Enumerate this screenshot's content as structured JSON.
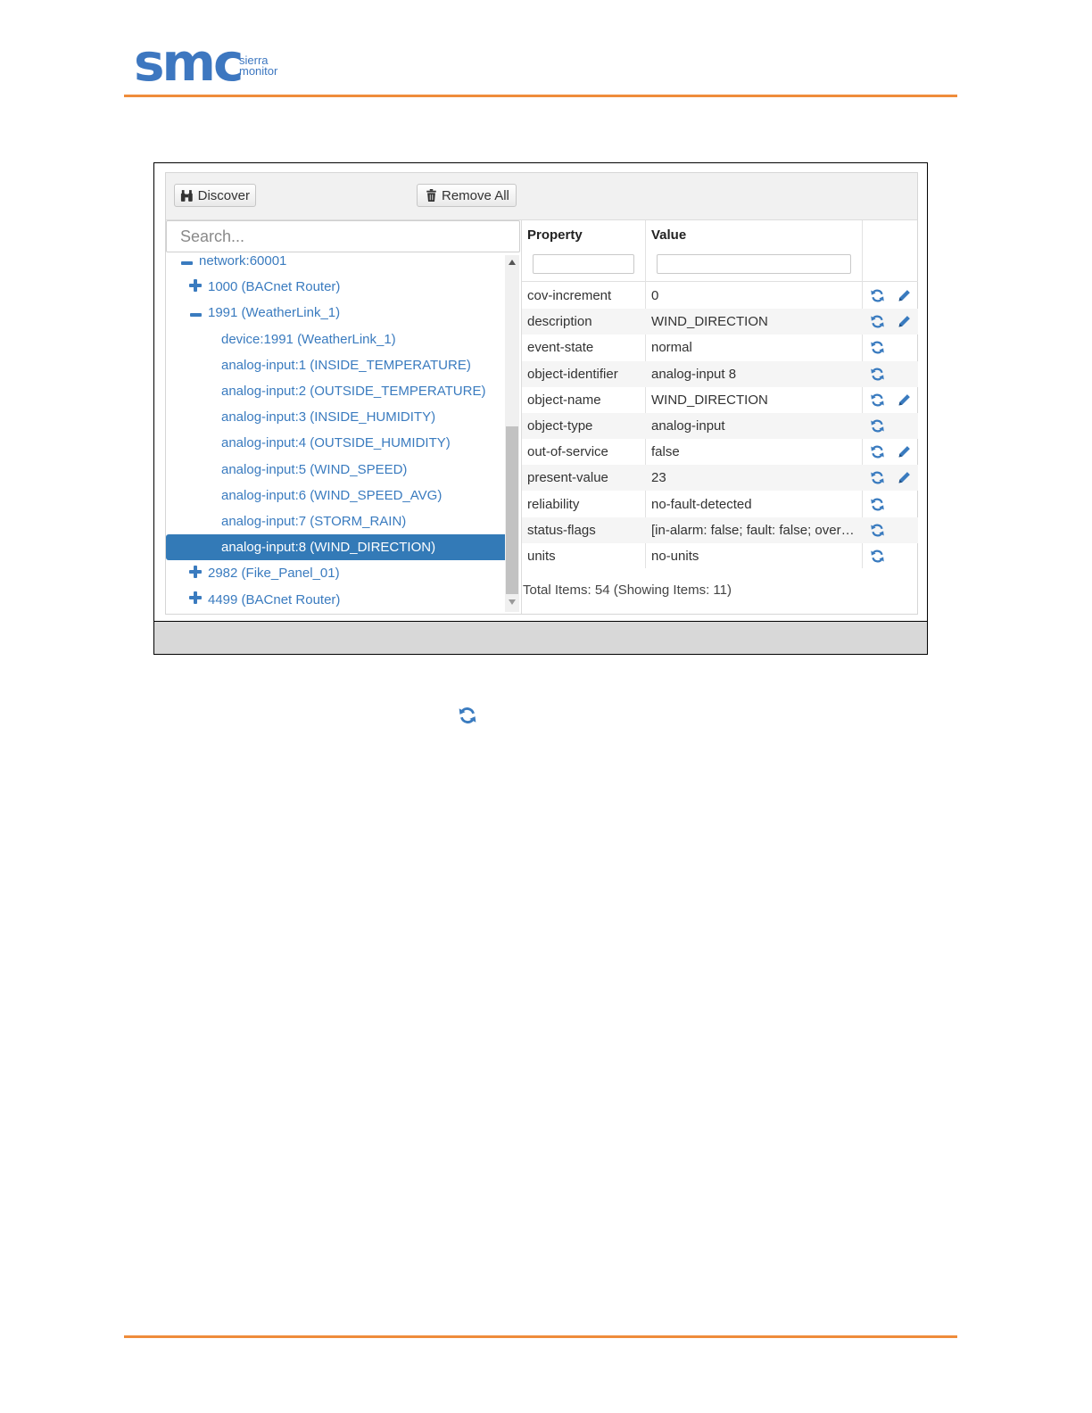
{
  "header": {
    "logo_text": "smc",
    "logo_sub_line1": "sierra",
    "logo_sub_line2": "monitor",
    "accent_color": "#ef8c3b",
    "brand_color": "#3d77c0"
  },
  "toolbar": {
    "discover_label": "Discover",
    "discover_icon": "binoculars-icon",
    "remove_all_label": "Remove All",
    "remove_all_icon": "trash-icon"
  },
  "search": {
    "placeholder": "Search..."
  },
  "tree": {
    "nodes": [
      {
        "label": "network:60001",
        "icon": "minus-icon",
        "level": 0
      },
      {
        "label": "1000 (BACnet Router)",
        "icon": "plus-icon",
        "level": 1
      },
      {
        "label": "1991 (WeatherLink_1)",
        "icon": "minus-icon",
        "level": 1
      },
      {
        "label": "device:1991 (WeatherLink_1)",
        "icon": "",
        "level": 2
      },
      {
        "label": "analog-input:1 (INSIDE_TEMPERATURE)",
        "icon": "",
        "level": 2
      },
      {
        "label": "analog-input:2 (OUTSIDE_TEMPERATURE)",
        "icon": "",
        "level": 2
      },
      {
        "label": "analog-input:3 (INSIDE_HUMIDITY)",
        "icon": "",
        "level": 2
      },
      {
        "label": "analog-input:4 (OUTSIDE_HUMIDITY)",
        "icon": "",
        "level": 2
      },
      {
        "label": "analog-input:5 (WIND_SPEED)",
        "icon": "",
        "level": 2
      },
      {
        "label": "analog-input:6 (WIND_SPEED_AVG)",
        "icon": "",
        "level": 2
      },
      {
        "label": "analog-input:7 (STORM_RAIN)",
        "icon": "",
        "level": 2
      },
      {
        "label": "analog-input:8 (WIND_DIRECTION)",
        "icon": "search-icon",
        "level": 2,
        "selected": true
      },
      {
        "label": "2982 (Fike_Panel_01)",
        "icon": "plus-icon",
        "level": 1
      },
      {
        "label": "4499 (BACnet Router)",
        "icon": "plus-icon",
        "level": 1
      }
    ]
  },
  "grid": {
    "header_property": "Property",
    "header_value": "Value",
    "rows": [
      {
        "property": "cov-increment",
        "value": "0",
        "refresh": true,
        "edit": true
      },
      {
        "property": "description",
        "value": "WIND_DIRECTION",
        "refresh": true,
        "edit": true
      },
      {
        "property": "event-state",
        "value": "normal",
        "refresh": true,
        "edit": false
      },
      {
        "property": "object-identifier",
        "value": "analog-input 8",
        "refresh": true,
        "edit": false
      },
      {
        "property": "object-name",
        "value": "WIND_DIRECTION",
        "refresh": true,
        "edit": true
      },
      {
        "property": "object-type",
        "value": "analog-input",
        "refresh": true,
        "edit": false
      },
      {
        "property": "out-of-service",
        "value": "false",
        "refresh": true,
        "edit": true
      },
      {
        "property": "present-value",
        "value": "23",
        "refresh": true,
        "edit": true
      },
      {
        "property": "reliability",
        "value": "no-fault-detected",
        "refresh": true,
        "edit": false
      },
      {
        "property": "status-flags",
        "value": "[in-alarm: false; fault: false; overri…",
        "refresh": true,
        "edit": false
      },
      {
        "property": "units",
        "value": "no-units",
        "refresh": true,
        "edit": false
      }
    ],
    "total_text": "Total Items: 54 (Showing Items: 11)"
  },
  "standalone_icon": "refresh-icon"
}
